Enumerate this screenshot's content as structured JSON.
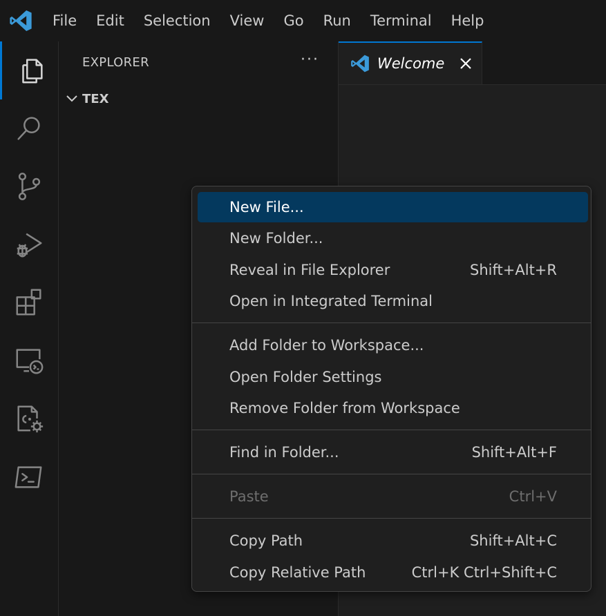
{
  "menubar": {
    "items": [
      "File",
      "Edit",
      "Selection",
      "View",
      "Go",
      "Run",
      "Terminal",
      "Help"
    ]
  },
  "activity_bar": {
    "icons": [
      "explorer-icon",
      "search-icon",
      "source-control-icon",
      "run-debug-icon",
      "extensions-icon",
      "remote-explorer-icon",
      "cpp-settings-icon",
      "terminal-icon"
    ],
    "active": "explorer-icon"
  },
  "sidebar": {
    "title": "EXPLORER",
    "more": "···",
    "folder": "TEX"
  },
  "editor": {
    "tab_label": "Welcome"
  },
  "context_menu": {
    "items": [
      {
        "label": "New File...",
        "shortcut": "",
        "selected": true
      },
      {
        "label": "New Folder...",
        "shortcut": ""
      },
      {
        "label": "Reveal in File Explorer",
        "shortcut": "Shift+Alt+R"
      },
      {
        "label": "Open in Integrated Terminal",
        "shortcut": ""
      },
      {
        "label": "Add Folder to Workspace...",
        "shortcut": ""
      },
      {
        "label": "Open Folder Settings",
        "shortcut": ""
      },
      {
        "label": "Remove Folder from Workspace",
        "shortcut": ""
      },
      {
        "label": "Find in Folder...",
        "shortcut": "Shift+Alt+F"
      },
      {
        "label": "Paste",
        "shortcut": "Ctrl+V",
        "disabled": true
      },
      {
        "label": "Copy Path",
        "shortcut": "Shift+Alt+C"
      },
      {
        "label": "Copy Relative Path",
        "shortcut": "Ctrl+K Ctrl+Shift+C"
      }
    ]
  },
  "colors": {
    "accent": "#0078d4",
    "selection": "#04395e",
    "logo": "#3b9ad9"
  }
}
